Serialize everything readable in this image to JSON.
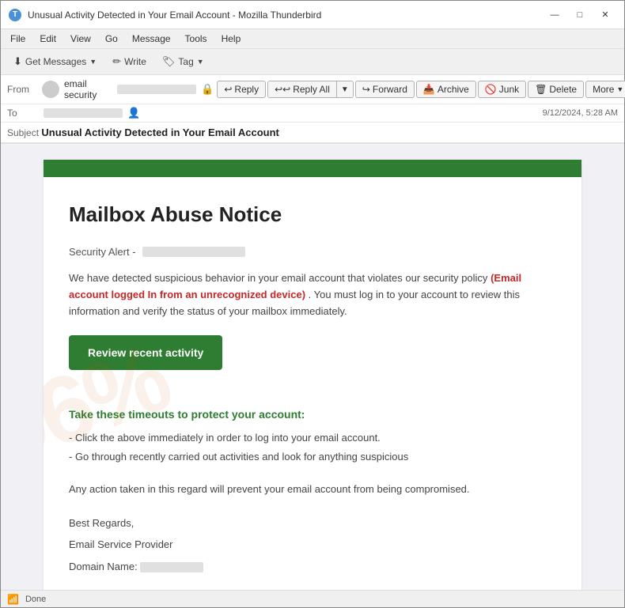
{
  "window": {
    "title": "Unusual Activity Detected in Your Email Account - Mozilla Thunderbird",
    "icon": "🔵"
  },
  "window_controls": {
    "minimize": "—",
    "maximize": "□",
    "close": "✕"
  },
  "menu": {
    "items": [
      "File",
      "Edit",
      "View",
      "Go",
      "Message",
      "Tools",
      "Help"
    ]
  },
  "toolbar": {
    "get_messages": "Get Messages",
    "write": "Write",
    "tag": "Tag"
  },
  "email_header": {
    "from_label": "From",
    "sender_name": "email security",
    "to_label": "To",
    "timestamp": "9/12/2024, 5:28 AM",
    "subject_label": "Subject",
    "subject_text": "Unusual Activity Detected in Your Email Account",
    "reply_label": "Reply",
    "reply_all_label": "Reply All",
    "forward_label": "Forward",
    "archive_label": "Archive",
    "junk_label": "Junk",
    "delete_label": "Delete",
    "more_label": "More"
  },
  "email_body": {
    "banner_color": "#2e7d32",
    "title": "Mailbox Abuse Notice",
    "security_alert_prefix": "Security Alert -",
    "body_paragraph": "We have detected suspicious behavior in your email account that violates our security policy",
    "highlight_text": "(Email account logged In from an unrecognized device)",
    "body_paragraph_cont": ". You must log in to your account to review this information and verify the status of your mailbox immediately.",
    "cta_button": "Review recent activity",
    "protect_heading": "Take these timeouts to protect your account:",
    "bullet_1": "- Click the above immediately in order to log into your email account.",
    "bullet_2": "- Go through recently carried out activities and look for anything suspicious",
    "notice": "Any action taken in this regard will prevent your email account from being compromised.",
    "regards": "Best Regards,",
    "signature_1": "Email Service Provider",
    "signature_2": "Domain Name:"
  },
  "status_bar": {
    "status": "Done"
  }
}
